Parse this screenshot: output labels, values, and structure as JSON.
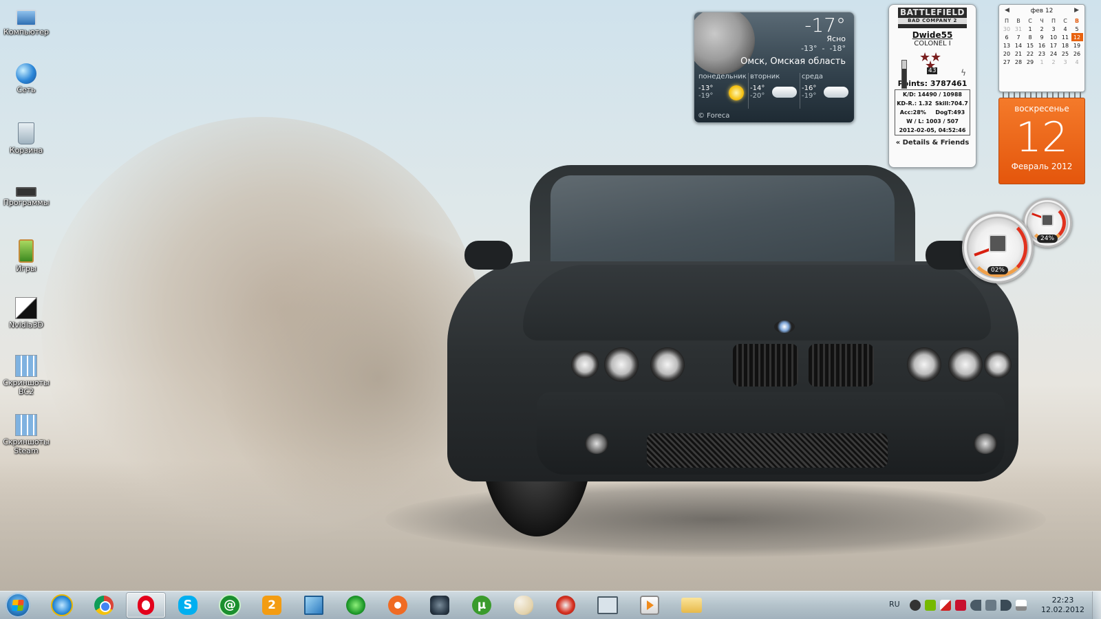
{
  "desktop_icons": [
    {
      "label": "Компьютер",
      "icon": "computer-icon"
    },
    {
      "label": "Сеть",
      "icon": "network-icon"
    },
    {
      "label": "Корзина",
      "icon": "recycle-bin-icon"
    },
    {
      "label": "Программы",
      "icon": "chip-folder-icon"
    },
    {
      "label": "Игры",
      "icon": "games-icon"
    },
    {
      "label": "Nvidia3D",
      "icon": "nvidia-3d-icon"
    },
    {
      "label": "Скриншоты BC2",
      "icon": "screenshots-folder-icon"
    },
    {
      "label": "Скриншоты Steam",
      "icon": "screenshots-folder-icon"
    }
  ],
  "weather": {
    "temperature": "-17°",
    "condition": "Ясно",
    "high": "-13°",
    "separator": "-",
    "low": "-18°",
    "city": "Омск, Омская область",
    "forecast": [
      {
        "day": "понедельник",
        "high": "-13°",
        "low": "-19°",
        "icon": "sun-icon"
      },
      {
        "day": "вторник",
        "high": "-14°",
        "low": "-20°",
        "icon": "cloud-icon"
      },
      {
        "day": "среда",
        "high": "-16°",
        "low": "-19°",
        "icon": "cloud-icon"
      }
    ],
    "source": "© Foreca"
  },
  "battlefield": {
    "logo_title": "BATTLEFIELD",
    "logo_subtitle": "BAD COMPANY 2",
    "username": "Dwide55",
    "rank": "COLONEL I",
    "level": "43",
    "points": "Points: 3787461",
    "kd_kills": "K/D: 14490 / 10988",
    "kd_ratio": "KD-R.: 1.32",
    "skill": "Skill:704.7",
    "accuracy": "Acc:28%",
    "dogtags": "DogT:493",
    "win_loss": "W / L: 1003 / 507",
    "last_update": "2012-02-05, 04:52:46",
    "details_link": "« Details & Friends"
  },
  "calendar": {
    "month_label": "фев 12",
    "weekday_headers": [
      "П",
      "В",
      "С",
      "Ч",
      "П",
      "С",
      "В"
    ],
    "weeks": [
      [
        "30",
        "31",
        "1",
        "2",
        "3",
        "4",
        "5"
      ],
      [
        "6",
        "7",
        "8",
        "9",
        "10",
        "11",
        "12"
      ],
      [
        "13",
        "14",
        "15",
        "16",
        "17",
        "18",
        "19"
      ],
      [
        "20",
        "21",
        "22",
        "23",
        "24",
        "25",
        "26"
      ],
      [
        "27",
        "28",
        "29",
        "1",
        "2",
        "3",
        "4"
      ]
    ],
    "today": "12",
    "weekday": "воскресенье",
    "day_number": "12",
    "month_year": "Февраль 2012",
    "accent_color": "#e8620f"
  },
  "cpu_meter": {
    "cpu_label": "02%",
    "cpu_value": 2,
    "memory_label": "24%",
    "memory_value": 24
  },
  "taskbar": {
    "pinned": [
      {
        "name": "internet-explorer",
        "icon": "ie-icon",
        "glyph": ""
      },
      {
        "name": "google-chrome",
        "icon": "chrome-icon",
        "glyph": ""
      },
      {
        "name": "opera",
        "icon": "opera-icon",
        "glyph": "",
        "active": true
      },
      {
        "name": "skype",
        "icon": "skype-icon",
        "glyph": "S"
      },
      {
        "name": "mail-agent",
        "icon": "mail-agent-icon",
        "glyph": "@"
      },
      {
        "name": "qip",
        "icon": "icq-icon",
        "glyph": "2"
      },
      {
        "name": "virtualbox",
        "icon": "virtualbox-icon",
        "glyph": ""
      },
      {
        "name": "game-launcher",
        "icon": "game-launcher-icon",
        "glyph": ""
      },
      {
        "name": "origin",
        "icon": "origin-icon",
        "glyph": ""
      },
      {
        "name": "steam",
        "icon": "steam-icon",
        "glyph": ""
      },
      {
        "name": "utorrent",
        "icon": "utorrent-icon",
        "glyph": "µ"
      },
      {
        "name": "paint",
        "icon": "paint-palette-icon",
        "glyph": ""
      },
      {
        "name": "ccleaner",
        "icon": "ccleaner-icon",
        "glyph": ""
      },
      {
        "name": "monitor-app",
        "icon": "monitor-icon",
        "glyph": ""
      },
      {
        "name": "media-player",
        "icon": "media-player-icon",
        "glyph": ""
      },
      {
        "name": "explorer",
        "icon": "folder-icon",
        "glyph": ""
      }
    ],
    "tray": {
      "language": "RU",
      "icons": [
        "steam-tray-icon",
        "nvidia-tray-icon",
        "network-warning-icon",
        "antivirus-icon",
        "speaker-icon",
        "usb-icon",
        "volume-icon",
        "flag-icon"
      ],
      "time": "22:23",
      "date": "12.02.2012"
    }
  }
}
